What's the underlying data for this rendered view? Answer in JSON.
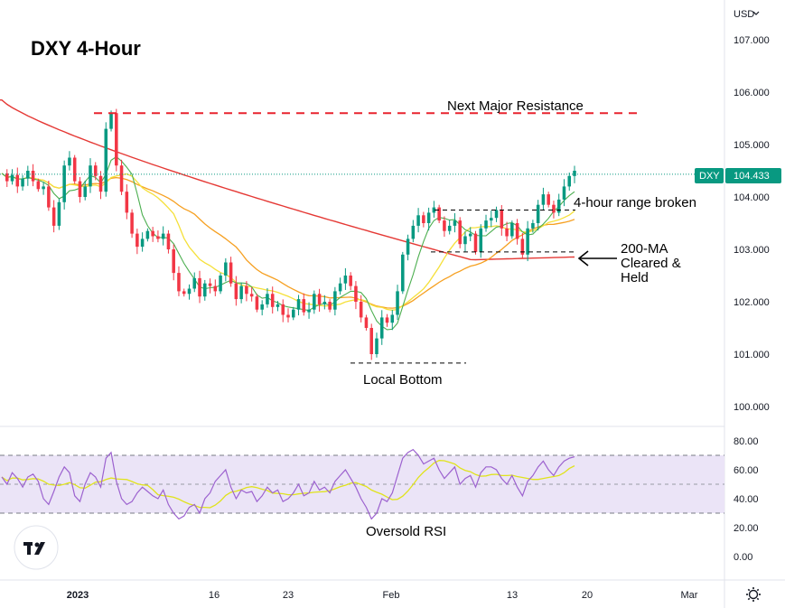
{
  "chart_data": {
    "type": "candlestick",
    "title": "DXY 4-Hour",
    "symbol": "DXY",
    "currency_menu": "USD",
    "last_price": "104.433",
    "price_axis": {
      "ylim": [
        99.6,
        107.6
      ],
      "ticks": [
        "107.000",
        "106.000",
        "105.000",
        "104.000",
        "103.000",
        "102.000",
        "101.000",
        "100.000"
      ]
    },
    "time_axis": {
      "ticks": [
        "2023",
        "16",
        "23",
        "Feb",
        "13",
        "20",
        "Mar"
      ]
    },
    "rsi": {
      "ylim": [
        -8,
        88
      ],
      "ticks": [
        "80.00",
        "60.00",
        "40.00",
        "20.00",
        "0.00"
      ],
      "band": [
        30,
        70
      ]
    },
    "price_path": [
      104.45,
      104.3,
      104.42,
      104.2,
      104.35,
      104.5,
      104.3,
      104.15,
      104.2,
      103.8,
      103.45,
      103.9,
      104.6,
      104.75,
      104.3,
      104.0,
      104.2,
      104.6,
      104.4,
      104.1,
      105.3,
      105.6,
      104.6,
      104.1,
      103.7,
      103.3,
      103.05,
      103.2,
      103.35,
      103.25,
      103.2,
      103.3,
      103.0,
      102.55,
      102.2,
      102.15,
      102.25,
      102.45,
      102.1,
      102.35,
      102.3,
      102.2,
      102.5,
      102.75,
      102.35,
      102.05,
      102.3,
      102.15,
      102.1,
      101.85,
      101.95,
      102.15,
      101.9,
      101.95,
      101.75,
      101.7,
      101.85,
      102.05,
      101.8,
      101.85,
      102.15,
      101.95,
      102.0,
      101.85,
      102.2,
      102.35,
      102.5,
      102.3,
      102.0,
      101.7,
      101.5,
      101.0,
      101.3,
      101.7,
      101.6,
      101.75,
      102.2,
      102.9,
      103.2,
      103.45,
      103.65,
      103.5,
      103.7,
      103.8,
      103.55,
      103.35,
      103.45,
      103.55,
      103.1,
      103.25,
      103.3,
      102.95,
      103.4,
      103.55,
      103.6,
      103.75,
      103.4,
      103.25,
      103.5,
      103.2,
      102.9,
      103.4,
      103.5,
      103.85,
      104.05,
      103.85,
      103.7,
      103.95,
      104.2,
      104.4,
      104.5
    ],
    "rsi_path": [
      55,
      50,
      58,
      54,
      48,
      55,
      57,
      52,
      40,
      36,
      45,
      55,
      62,
      58,
      42,
      38,
      50,
      58,
      55,
      48,
      68,
      72,
      52,
      40,
      36,
      38,
      44,
      48,
      45,
      42,
      40,
      46,
      36,
      30,
      26,
      28,
      34,
      36,
      30,
      40,
      44,
      52,
      56,
      60,
      48,
      40,
      46,
      44,
      45,
      38,
      42,
      48,
      44,
      46,
      38,
      40,
      44,
      50,
      42,
      44,
      52,
      46,
      48,
      44,
      52,
      56,
      60,
      54,
      48,
      40,
      34,
      26,
      30,
      40,
      38,
      44,
      56,
      68,
      72,
      74,
      70,
      64,
      66,
      68,
      60,
      54,
      58,
      62,
      50,
      54,
      56,
      48,
      58,
      62,
      62,
      60,
      54,
      50,
      56,
      48,
      42,
      52,
      56,
      62,
      66,
      60,
      56,
      62,
      66,
      68,
      69
    ],
    "annotations": {
      "resistance": "Next Major Resistance",
      "range_broken": "4-hour range broken",
      "ma_line1": "200-MA",
      "ma_line2": "Cleared &",
      "ma_line3": "Held",
      "local_bottom": "Local Bottom",
      "oversold": "Oversold RSI"
    },
    "levels": {
      "resistance": 105.6,
      "range_top": 103.75,
      "ma_cleared": 102.95,
      "local_bottom": 100.83
    },
    "colors": {
      "up": "#089981",
      "down": "#f23645",
      "sma_fast": "#4caf50",
      "sma_mid": "#f5e03a",
      "sma_slow": "#f6a021",
      "sma_200": "#e53935",
      "rsi_line": "#9c62cf",
      "rsi_ma": "#e0e31c",
      "rsi_band": "#ebe4f7",
      "price_tag": "#089981"
    }
  }
}
